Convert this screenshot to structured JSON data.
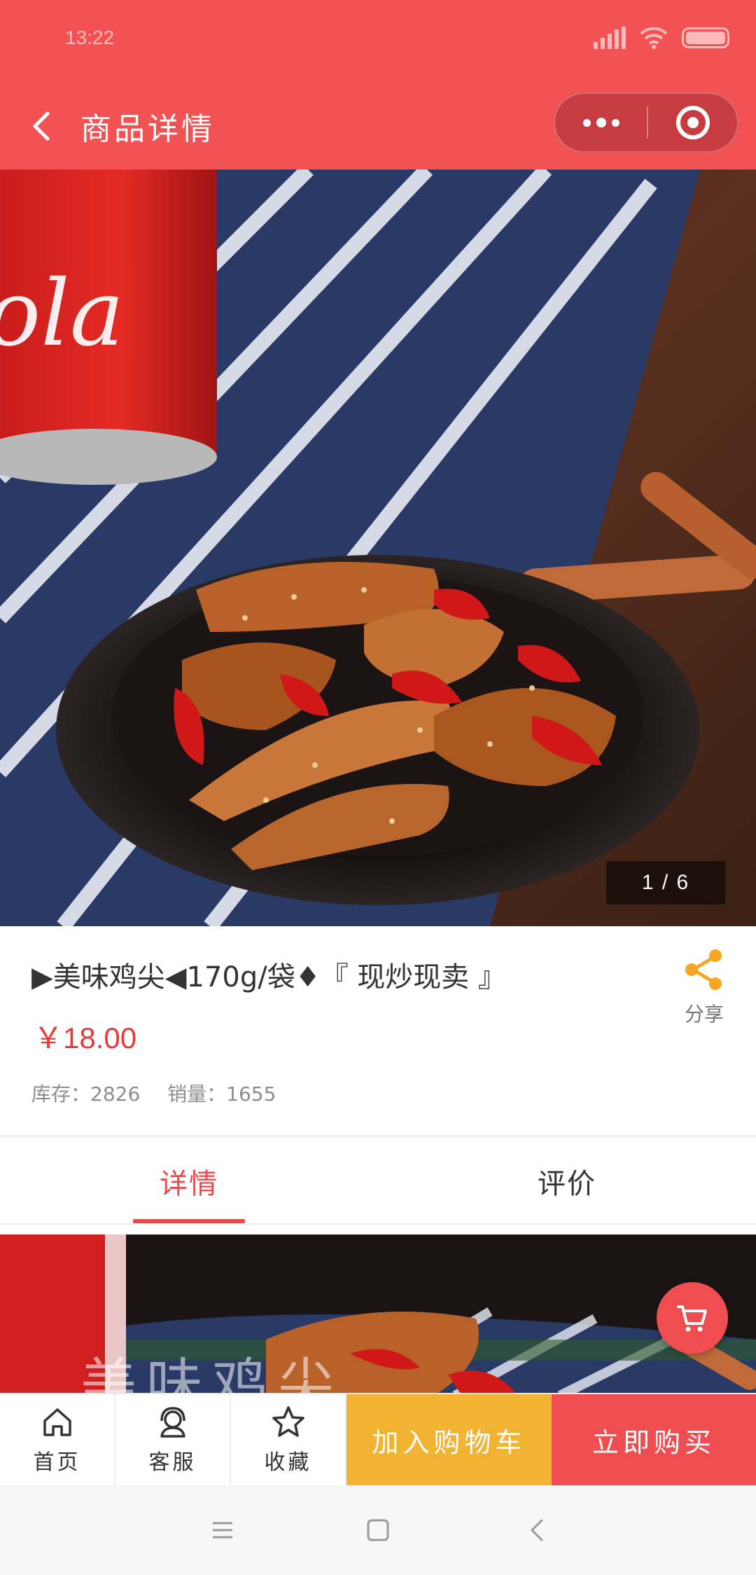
{
  "status_bar": {
    "time": "13:22"
  },
  "nav": {
    "title": "商品详情"
  },
  "gallery": {
    "counter": "1 / 6",
    "current": 1,
    "total": 6
  },
  "product": {
    "title": "▶美味鸡尖◀170g/袋♦『 现炒现卖 』",
    "price": "￥18.00",
    "stock_label": "库存：2826",
    "sales_label": "销量：1655"
  },
  "share": {
    "label": "分享"
  },
  "tabs": [
    {
      "label": "详情",
      "active": true
    },
    {
      "label": "评价",
      "active": false
    }
  ],
  "detail": {
    "overlay_text": "美味鸡尖"
  },
  "bottom_bar": {
    "home_label": "首页",
    "service_label": "客服",
    "favorite_label": "收藏",
    "add_cart_label": "加入购物车",
    "buy_now_label": "立即购买"
  },
  "colors": {
    "brand_red": "#f25253",
    "price_red": "#e73b3b",
    "cart_yellow": "#f2b232",
    "share_orange": "#f5a623"
  }
}
